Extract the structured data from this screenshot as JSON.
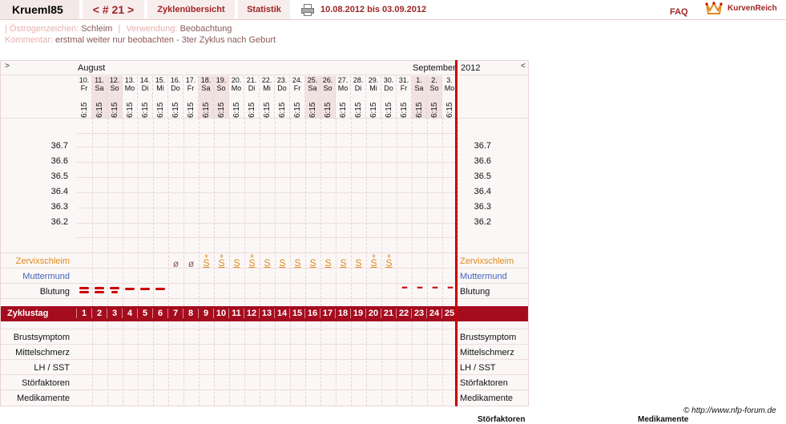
{
  "nav": {
    "username": "Krueml85",
    "cycle_prev": "<",
    "cycle_label": "# 21",
    "cycle_next": ">",
    "tab_overview": "Zyklenübersicht",
    "tab_stats": "Statistik",
    "date_range": "10.08.2012 bis 03.09.2012",
    "faq": "FAQ",
    "logo_text": "KurvenReich",
    "printer_icon": "printer-icon",
    "logo_icon": "crown-icon"
  },
  "info": {
    "oestrogen_label": "Östrogenzeichen:",
    "oestrogen_value": "Schleim",
    "usage_label": "Verwendung:",
    "usage_value": "Beobachtung",
    "comment_label": "Kommentar:",
    "comment_value": "erstmal weiter nur beobachten - 3ter Zyklus nach Geburt"
  },
  "chart_data": {
    "type": "table",
    "nav_left": ">",
    "nav_right": "<",
    "month_start": "August",
    "month_end": "September",
    "year": "2012",
    "days": [
      {
        "d": "10.",
        "w": "Fr",
        "t": "6:15"
      },
      {
        "d": "11.",
        "w": "Sa",
        "t": "6:15"
      },
      {
        "d": "12.",
        "w": "So",
        "t": "6:15"
      },
      {
        "d": "13.",
        "w": "Mo",
        "t": "6:15"
      },
      {
        "d": "14.",
        "w": "Di",
        "t": "6:15"
      },
      {
        "d": "15.",
        "w": "Mi",
        "t": "6:15"
      },
      {
        "d": "16.",
        "w": "Do",
        "t": "6:15"
      },
      {
        "d": "17.",
        "w": "Fr",
        "t": "6:15"
      },
      {
        "d": "18.",
        "w": "Sa",
        "t": "6:15"
      },
      {
        "d": "19.",
        "w": "So",
        "t": "6:15"
      },
      {
        "d": "20.",
        "w": "Mo",
        "t": "6:15"
      },
      {
        "d": "21.",
        "w": "Di",
        "t": "6:15"
      },
      {
        "d": "22.",
        "w": "Mi",
        "t": "6:15"
      },
      {
        "d": "23.",
        "w": "Do",
        "t": "6:15"
      },
      {
        "d": "24.",
        "w": "Fr",
        "t": "6:15"
      },
      {
        "d": "25.",
        "w": "Sa",
        "t": "6:15"
      },
      {
        "d": "26.",
        "w": "So",
        "t": "6:15"
      },
      {
        "d": "27.",
        "w": "Mo",
        "t": "6:15"
      },
      {
        "d": "28.",
        "w": "Di",
        "t": "6:15"
      },
      {
        "d": "29.",
        "w": "Mi",
        "t": "6:15"
      },
      {
        "d": "30.",
        "w": "Do",
        "t": "6:15"
      },
      {
        "d": "31.",
        "w": "Fr",
        "t": "6:15"
      },
      {
        "d": "1.",
        "w": "Sa",
        "t": "6:15"
      },
      {
        "d": "2.",
        "w": "So",
        "t": "6:15"
      },
      {
        "d": "3.",
        "w": "Mo",
        "t": "6:15"
      }
    ],
    "temp_ticks": [
      "36.7",
      "36.6",
      "36.5",
      "36.4",
      "36.3",
      "36.2"
    ],
    "temperatures": [],
    "row_labels": {
      "cervix": "Zervixschleim",
      "mouth": "Muttermund",
      "bleeding": "Blutung",
      "cycle_day": "Zyklustag",
      "breast": "Brustsymptom",
      "midpain": "Mittelschmerz",
      "lh": "LH / SST",
      "disturb": "Störfaktoren",
      "meds": "Medikamente"
    },
    "cervix": [
      {
        "day": 7,
        "sym": "ø"
      },
      {
        "day": 8,
        "sym": "ø"
      },
      {
        "day": 9,
        "sym": "S",
        "plus": true
      },
      {
        "day": 10,
        "sym": "S",
        "plus": true
      },
      {
        "day": 11,
        "sym": "S"
      },
      {
        "day": 12,
        "sym": "S",
        "plus": true
      },
      {
        "day": 13,
        "sym": "S"
      },
      {
        "day": 14,
        "sym": "S"
      },
      {
        "day": 15,
        "sym": "S"
      },
      {
        "day": 16,
        "sym": "S"
      },
      {
        "day": 17,
        "sym": "S"
      },
      {
        "day": 18,
        "sym": "S"
      },
      {
        "day": 19,
        "sym": "S"
      },
      {
        "day": 20,
        "sym": "S",
        "plus": true
      },
      {
        "day": 21,
        "sym": "S",
        "plus": true
      }
    ],
    "bleeding": [
      {
        "day": 1,
        "level": "heavy"
      },
      {
        "day": 2,
        "level": "heavy"
      },
      {
        "day": 3,
        "level": "medium"
      },
      {
        "day": 4,
        "level": "light"
      },
      {
        "day": 5,
        "level": "light"
      },
      {
        "day": 6,
        "level": "light"
      },
      {
        "day": 22,
        "level": "spotting"
      },
      {
        "day": 23,
        "level": "spotting"
      },
      {
        "day": 24,
        "level": "spotting"
      },
      {
        "day": 25,
        "level": "spotting"
      }
    ],
    "cycle_days": [
      "1",
      "2",
      "3",
      "4",
      "5",
      "6",
      "7",
      "8",
      "9",
      "10",
      "11",
      "12",
      "13",
      "14",
      "15",
      "16",
      "17",
      "18",
      "19",
      "20",
      "21",
      "22",
      "23",
      "24",
      "25"
    ]
  },
  "footer": {
    "copyright": "© http://www.nfp-forum.de",
    "cut_disturb": "Störfaktoren",
    "cut_meds": "Medikamente"
  }
}
